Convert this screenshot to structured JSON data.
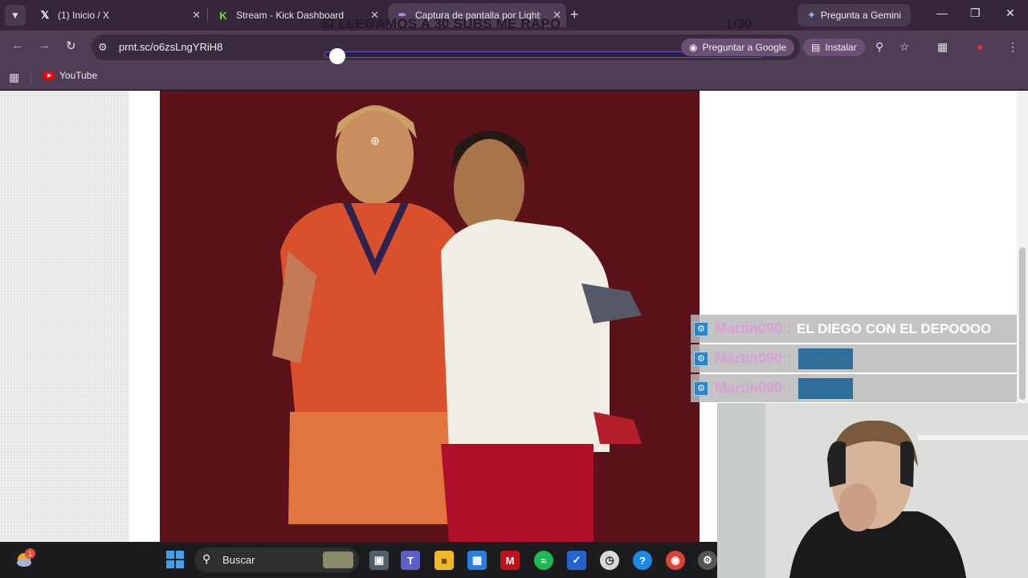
{
  "tabs": [
    {
      "title": "(1) Inicio / X",
      "icon": "x-logo-icon"
    },
    {
      "title": "Stream - Kick Dashboard",
      "icon": "kick-logo-icon"
    },
    {
      "title": "Captura de pantalla por Lightsh",
      "icon": "lightshot-feather-icon"
    }
  ],
  "overlay": {
    "goal_text": "SI LLEGAMOS A 30 SUBS ME RAPO",
    "goal_count": "1/30",
    "goal_progress": 0.03
  },
  "gemini_button": "Pregunta a Gemini",
  "address_bar": {
    "url": "prnt.sc/o6zsLngYRiH8"
  },
  "toolbar": {
    "ask_google": "Preguntar a Google",
    "install": "Instalar"
  },
  "bookmarks": [
    {
      "label": "YouTube"
    }
  ],
  "chat": [
    {
      "user": "Martin090",
      "separator": ":",
      "message": "EL DIEGO CON EL DEPOOOO",
      "emote": false
    },
    {
      "user": "Martin090",
      "separator": ":",
      "message": "",
      "emote": true
    },
    {
      "user": "Martin090",
      "separator": ":",
      "message": "",
      "emote": true
    }
  ],
  "taskbar": {
    "search_label": "Buscar",
    "weather_badge": "1",
    "icons": [
      "windows-start-icon",
      "task-view-icon",
      "teams-icon",
      "file-explorer-icon",
      "store-icon",
      "mcafee-icon",
      "spotify-icon",
      "todo-icon",
      "clock-icon",
      "help-icon",
      "chrome-icon",
      "settings-icon"
    ]
  },
  "colors": {
    "tab_bar": "#35263a",
    "toolbar": "#4f3d55",
    "photo_bg": "#5c141a",
    "chat_user": "#d9a0d6",
    "progress_accent": "#6a4fd0"
  }
}
